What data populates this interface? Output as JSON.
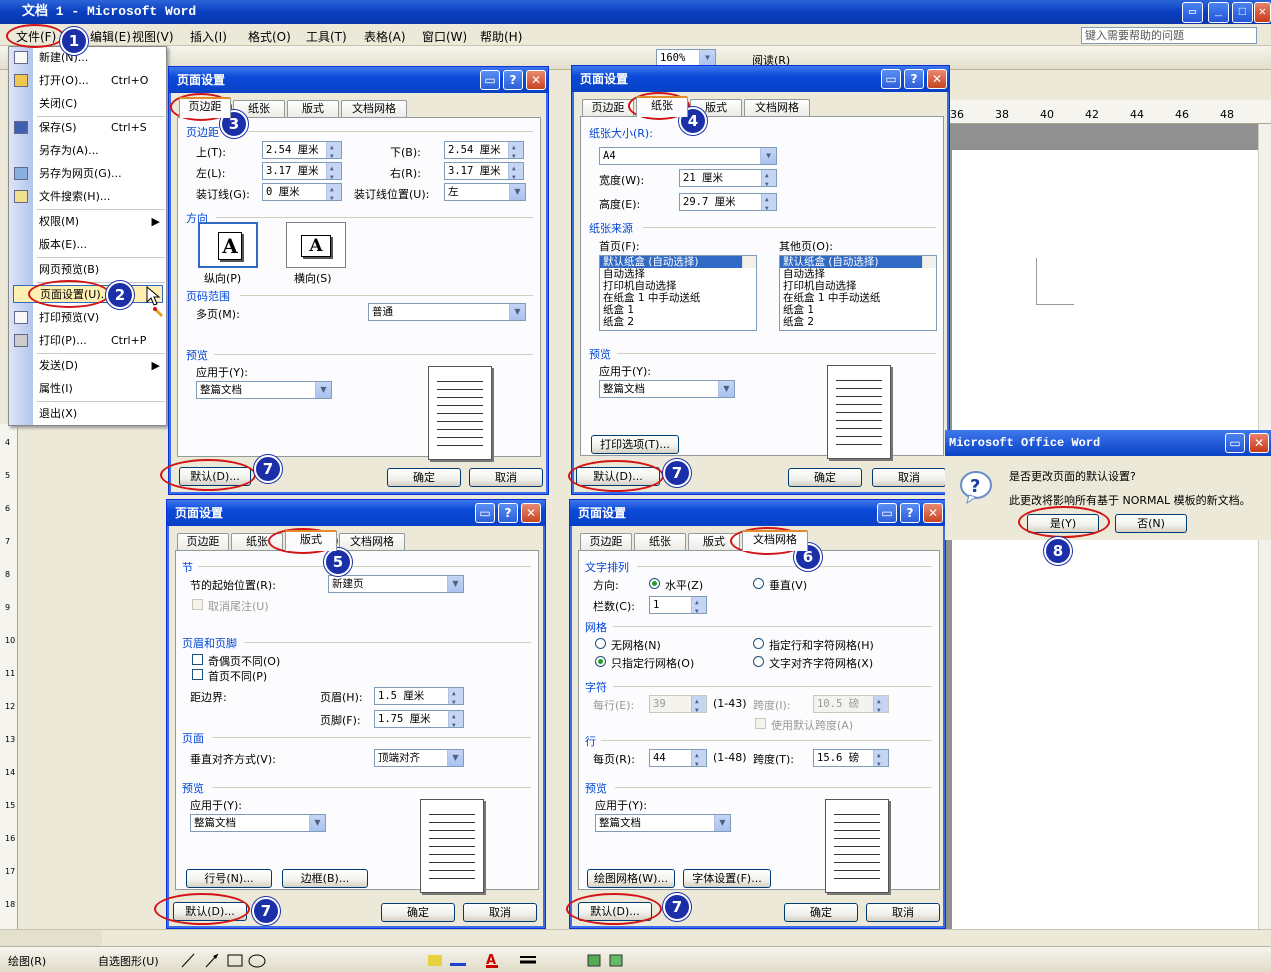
{
  "window": {
    "title": "文档 1 - Microsoft Word"
  },
  "menubar": {
    "items": [
      "文件(F)",
      "编辑(E)",
      "视图(V)",
      "插入(I)",
      "格式(O)",
      "工具(T)",
      "表格(A)",
      "窗口(W)",
      "帮助(H)"
    ],
    "help_placeholder": "键入需要帮助的问题"
  },
  "toolbar": {
    "zoom": "160%",
    "reading": "阅读(R)"
  },
  "file_menu": {
    "items": [
      {
        "label": "新建(N)...",
        "shortcut": ""
      },
      {
        "label": "打开(O)...",
        "shortcut": "Ctrl+O"
      },
      {
        "label": "关闭(C)",
        "shortcut": ""
      },
      {
        "label": "保存(S)",
        "shortcut": "Ctrl+S"
      },
      {
        "label": "另存为(A)...",
        "shortcut": ""
      },
      {
        "label": "另存为网页(G)...",
        "shortcut": ""
      },
      {
        "label": "文件搜索(H)...",
        "shortcut": ""
      },
      {
        "label": "权限(M)",
        "shortcut": ""
      },
      {
        "label": "版本(E)...",
        "shortcut": ""
      },
      {
        "label": "网页预览(B)",
        "shortcut": ""
      },
      {
        "label": "页面设置(U)...",
        "shortcut": ""
      },
      {
        "label": "打印预览(V)",
        "shortcut": ""
      },
      {
        "label": "打印(P)...",
        "shortcut": "Ctrl+P"
      },
      {
        "label": "发送(D)",
        "shortcut": ""
      },
      {
        "label": "属性(I)",
        "shortcut": ""
      },
      {
        "label": "退出(X)",
        "shortcut": ""
      }
    ]
  },
  "dialog_common": {
    "title": "页面设置",
    "tabs": [
      "页边距",
      "纸张",
      "版式",
      "文档网格"
    ],
    "preview": "预览",
    "apply_to": "应用于(Y):",
    "apply_value": "整篇文档",
    "default_btn": "默认(D)...",
    "ok_btn": "确定",
    "cancel_btn": "取消"
  },
  "margins": {
    "section": "页边距",
    "top_label": "上(T):",
    "top": "2.54 厘米",
    "bottom_label": "下(B):",
    "bottom": "2.54 厘米",
    "left_label": "左(L):",
    "left": "3.17 厘米",
    "right_label": "右(R):",
    "right": "3.17 厘米",
    "gutter_label": "装订线(G):",
    "gutter": "0 厘米",
    "gutter_pos_label": "装订线位置(U):",
    "gutter_pos": "左",
    "orientation": "方向",
    "portrait": "纵向(P)",
    "landscape": "横向(S)",
    "pages_section": "页码范围",
    "multi_label": "多页(M):",
    "multi": "普通"
  },
  "paper": {
    "size_label": "纸张大小(R):",
    "size": "A4",
    "width_label": "宽度(W):",
    "width": "21 厘米",
    "height_label": "高度(E):",
    "height": "29.7 厘米",
    "source": "纸张来源",
    "first_label": "首页(F):",
    "other_label": "其他页(O):",
    "trays": [
      "默认纸盒 (自动选择)",
      "自动选择",
      "打印机自动选择",
      "在纸盒 1 中手动送纸",
      "纸盒 1",
      "纸盒 2"
    ],
    "print_options": "打印选项(T)..."
  },
  "layout": {
    "section_label": "节",
    "start_label": "节的起始位置(R):",
    "start": "新建页",
    "suppress_endnotes": "取消尾注(U)",
    "hf_section": "页眉和页脚",
    "odd_even": "奇偶页不同(O)",
    "first_page": "首页不同(P)",
    "from_edge": "距边界:",
    "header_label": "页眉(H):",
    "header": "1.5 厘米",
    "footer_label": "页脚(F):",
    "footer": "1.75 厘米",
    "page_section": "页面",
    "valign_label": "垂直对齐方式(V):",
    "valign": "顶端对齐",
    "line_numbers": "行号(N)...",
    "borders": "边框(B)..."
  },
  "grid": {
    "text_dir_section": "文字排列",
    "direction_label": "方向:",
    "horizontal": "水平(Z)",
    "vertical": "垂直(V)",
    "columns_label": "栏数(C):",
    "columns": "1",
    "grid_section": "网格",
    "no_grid": "无网格(N)",
    "lines_and_chars": "指定行和字符网格(H)",
    "lines_only": "只指定行网格(O)",
    "snap_chars": "文字对齐字符网格(X)",
    "chars_section": "字符",
    "per_line_label": "每行(E):",
    "per_line": "39",
    "per_line_range": "(1-43)",
    "char_pitch_label": "跨度(I):",
    "char_pitch": "10.5 磅",
    "use_default_pitch": "使用默认跨度(A)",
    "lines_section": "行",
    "per_page_label": "每页(R):",
    "per_page": "44",
    "per_page_range": "(1-48)",
    "line_pitch_label": "跨度(T):",
    "line_pitch": "15.6 磅",
    "draw_grid": "绘图网格(W)...",
    "font_settings": "字体设置(F)..."
  },
  "confirm": {
    "title": "Microsoft Office Word",
    "question": "是否更改页面的默认设置?",
    "detail": "此更改将影响所有基于 NORMAL 模板的新文档。",
    "yes": "是(Y)",
    "no": "否(N)"
  },
  "ruler": {
    "ticks": [
      "36",
      "38",
      "40",
      "42",
      "44",
      "46",
      "48"
    ]
  },
  "vruler": {
    "ticks": [
      "4",
      "5",
      "6",
      "7",
      "8",
      "9",
      "10",
      "11",
      "12",
      "13",
      "14",
      "15",
      "16",
      "17",
      "18"
    ]
  },
  "drawbar": {
    "draw": "绘图(R)",
    "autoshapes": "自选图形(U)"
  },
  "steps": [
    "1",
    "2",
    "3",
    "4",
    "5",
    "6",
    "7",
    "8"
  ],
  "colors": {
    "title_blue": "#0A3FC0",
    "annotation_red": "#D21414",
    "badge_blue": "#1B2FA8"
  }
}
